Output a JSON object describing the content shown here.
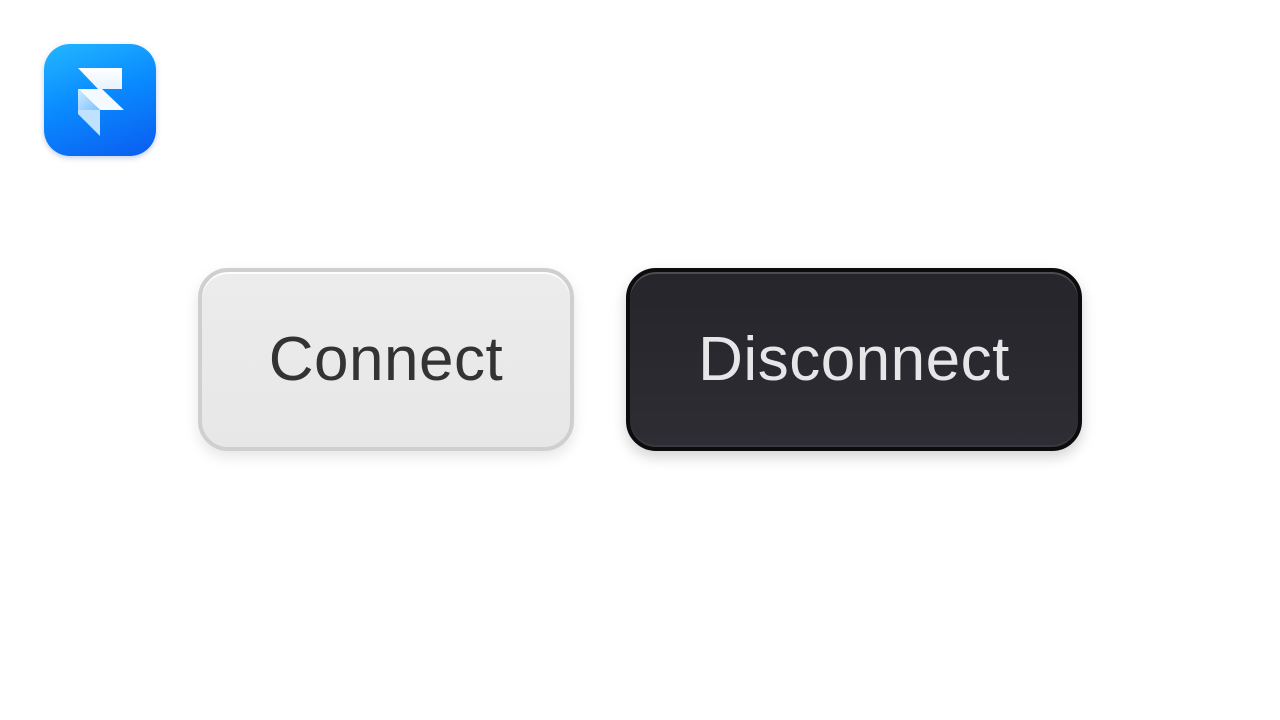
{
  "app": {
    "icon": "framer-logo-icon",
    "accent_color": "#0a8cff"
  },
  "buttons": {
    "connect_label": "Connect",
    "disconnect_label": "Disconnect"
  },
  "colors": {
    "connect_bg": "#e9e9e9",
    "connect_text": "#333333",
    "disconnect_bg": "#2a2930",
    "disconnect_text": "#e6e6e8"
  }
}
